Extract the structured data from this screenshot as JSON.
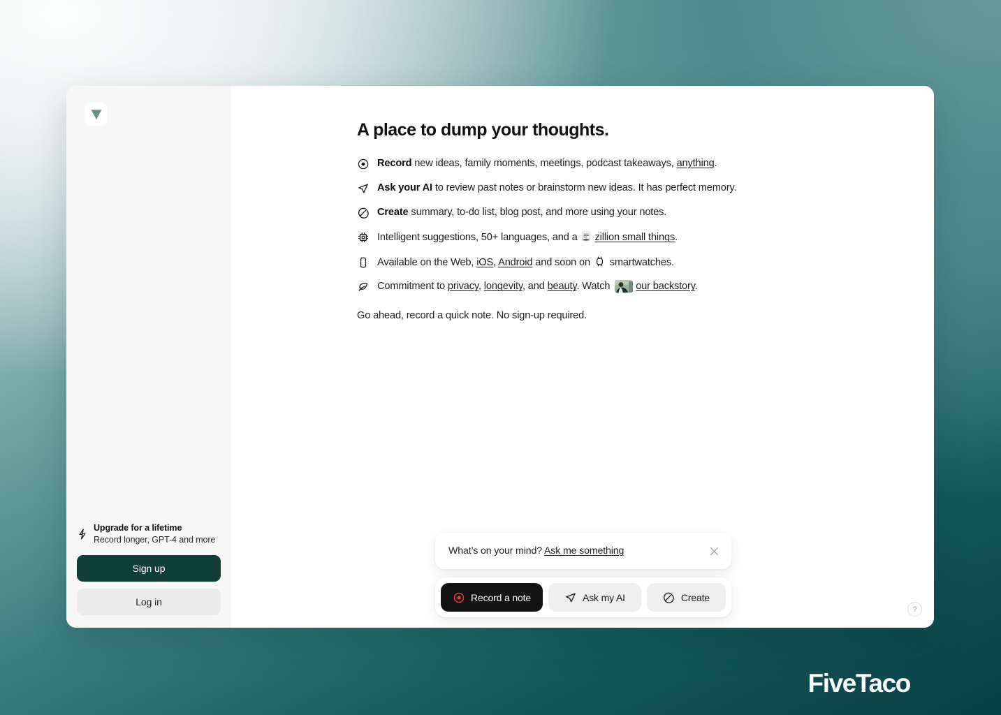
{
  "window": {
    "sidebar": {
      "logo_name": "app-logo",
      "upgrade": {
        "icon": "lightning-bolt-icon",
        "title": "Upgrade for a lifetime",
        "subtitle": "Record longer, GPT-4 and more"
      },
      "signup_label": "Sign up",
      "login_label": "Log in"
    },
    "main": {
      "headline": "A place to dump your thoughts.",
      "features": [
        {
          "icon": "record-circle-icon",
          "lead": "Record",
          "text_before_link": " new ideas, family moments, meetings, podcast takeaways, ",
          "link": "anything",
          "text_after_link": "."
        },
        {
          "icon": "paper-plane-icon",
          "lead": "Ask your AI",
          "text_before_link": " to review past notes or brainstorm new ideas. It has perfect memory.",
          "link": "",
          "text_after_link": ""
        },
        {
          "icon": "create-slash-circle-icon",
          "lead": "Create",
          "text_before_link": " summary, to-do list, blog post, and more using your notes.",
          "link": "",
          "text_after_link": ""
        },
        {
          "icon": "cpu-chip-icon",
          "lead": "",
          "text_before_link": "Intelligent suggestions, 50+ languages, and a ",
          "emoji": "pages-emoji",
          "link": "zillion small things",
          "text_after_link": "."
        },
        {
          "icon": "mobile-phone-icon",
          "lead": "",
          "text_before_link": "Available on the Web, ",
          "link": "iOS",
          "link2": "Android",
          "middle": ", ",
          "text_after_link": " and soon on ",
          "watch_icon": "smartwatch-icon",
          "tail": " smartwatches."
        },
        {
          "icon": "leaf-icon",
          "lead": "",
          "text_before_link": "Commitment to ",
          "link": "privacy",
          "link2": "longevity",
          "link3": "beauty",
          "sep1": ", ",
          "sep2": ", and ",
          "text_after_link": ". Watch ",
          "thumb": "backstory-video-thumbnail",
          "link4": "our backstory",
          "tail": "."
        }
      ],
      "closing": "Go ahead, record a quick note. No sign-up required.",
      "composer": {
        "prompt_static": "What’s on your mind? ",
        "prompt_link": "Ask me something",
        "close_icon": "close-icon",
        "actions": [
          {
            "icon": "record-circle-icon",
            "label": "Record a note",
            "style": "primary"
          },
          {
            "icon": "paper-plane-icon",
            "label": "Ask my AI",
            "style": "ghost"
          },
          {
            "icon": "create-slash-circle-icon",
            "label": "Create",
            "style": "ghost"
          }
        ]
      },
      "help_label": "?"
    }
  },
  "watermark": "FiveTaco",
  "colors": {
    "brand_dark_green": "#123e3a",
    "record_red": "#ef3b2d",
    "primary_black": "#121212",
    "sidebar_bg": "#f7f7f8",
    "backdrop_deep_teal": "#0c5053"
  }
}
